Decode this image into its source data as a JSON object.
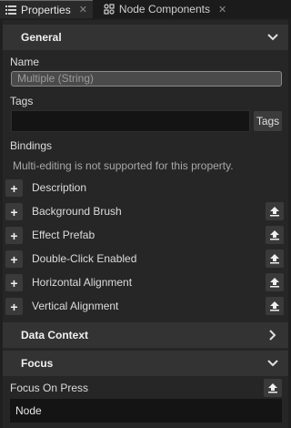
{
  "tabs": [
    {
      "label": "Properties",
      "icon": "list-icon",
      "close": "✕"
    },
    {
      "label": "Node Components",
      "icon": "components-icon",
      "close": "✕"
    }
  ],
  "general": {
    "title": "General",
    "name_label": "Name",
    "name_placeholder": "Multiple (String)",
    "tags_label": "Tags",
    "tags_button": "Tags",
    "bindings_label": "Bindings",
    "bindings_note": "Multi-editing is not supported for this property."
  },
  "bindings": [
    {
      "label": "Description",
      "has_upload": false
    },
    {
      "label": "Background Brush",
      "has_upload": true
    },
    {
      "label": "Effect Prefab",
      "has_upload": true
    },
    {
      "label": "Double-Click Enabled",
      "has_upload": true
    },
    {
      "label": "Horizontal Alignment",
      "has_upload": true
    },
    {
      "label": "Vertical Alignment",
      "has_upload": true
    }
  ],
  "data_context": {
    "title": "Data Context"
  },
  "focus": {
    "title": "Focus",
    "focus_on_press_label": "Focus On Press",
    "dropdown_value": "Node"
  },
  "colors": {
    "background": "#1f1f1f",
    "panel": "#262626",
    "section_header": "#333333",
    "input_dark": "#141414"
  }
}
